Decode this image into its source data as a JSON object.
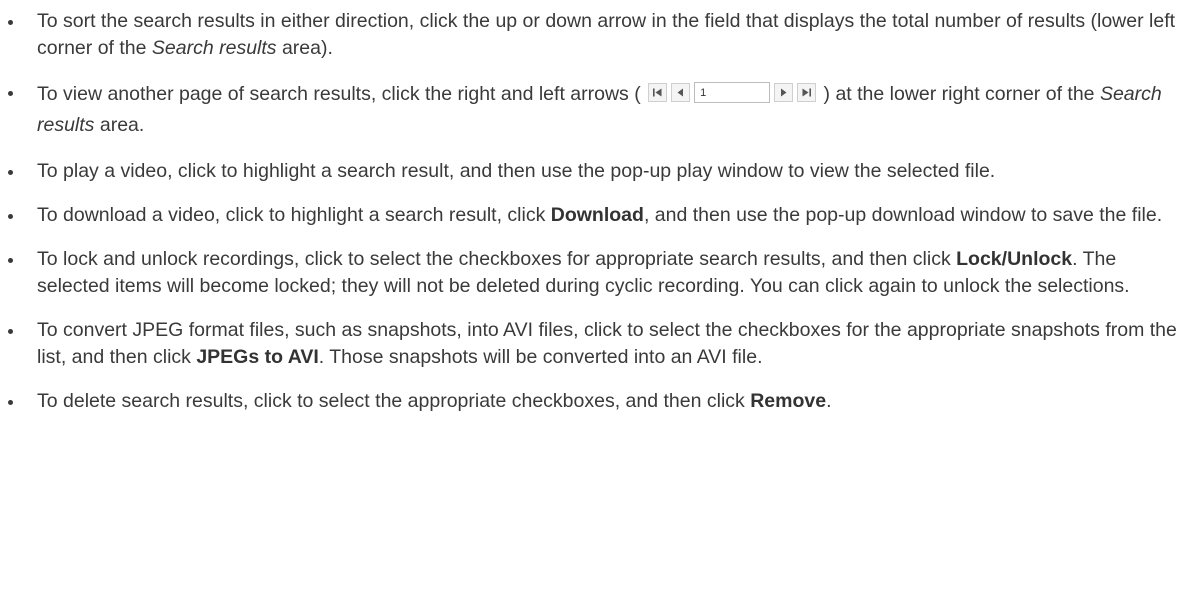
{
  "items": [
    {
      "a": "To sort the search results in either direction, click the up or down arrow in the field that displays the total number of results (lower left corner of the ",
      "em": "Search results",
      "b": " area)."
    },
    {
      "a": "To view another page of search results, click the right and left arrows (",
      "pager_value": "1",
      "b": ") at the lower right corner of the ",
      "em": "Search results",
      "c": " area."
    },
    {
      "a": "To play a video, click to highlight a search result, and then use the pop-up play window to view the selected file."
    },
    {
      "a": "To download a video, click to highlight a search result, click ",
      "strong": "Download",
      "b": ", and then use the pop-up download window to save the file."
    },
    {
      "a": "To lock and unlock recordings, click to select the checkboxes for appropriate search results, and then click ",
      "strong": "Lock/Unlock",
      "b": ". The selected items will become locked; they will not be deleted during cyclic recording. You can click again to unlock the selections."
    },
    {
      "a": "To convert JPEG format files, such as snapshots, into AVI files, click to select the checkboxes for the appropriate snapshots from the list, and then click ",
      "strong": "JPEGs to AVI",
      "b": ". Those snapshots will be converted into an AVI file."
    },
    {
      "a": "To delete search results, click to select the appropriate checkboxes, and then click ",
      "strong": "Remove",
      "b": "."
    }
  ],
  "pager_icons": [
    "first-page-icon",
    "prev-page-icon",
    "next-page-icon",
    "last-page-icon"
  ],
  "colors": {
    "text": "#3a3a3a",
    "button_bg": "#f4f4f4",
    "button_border": "#cfcfcf"
  }
}
